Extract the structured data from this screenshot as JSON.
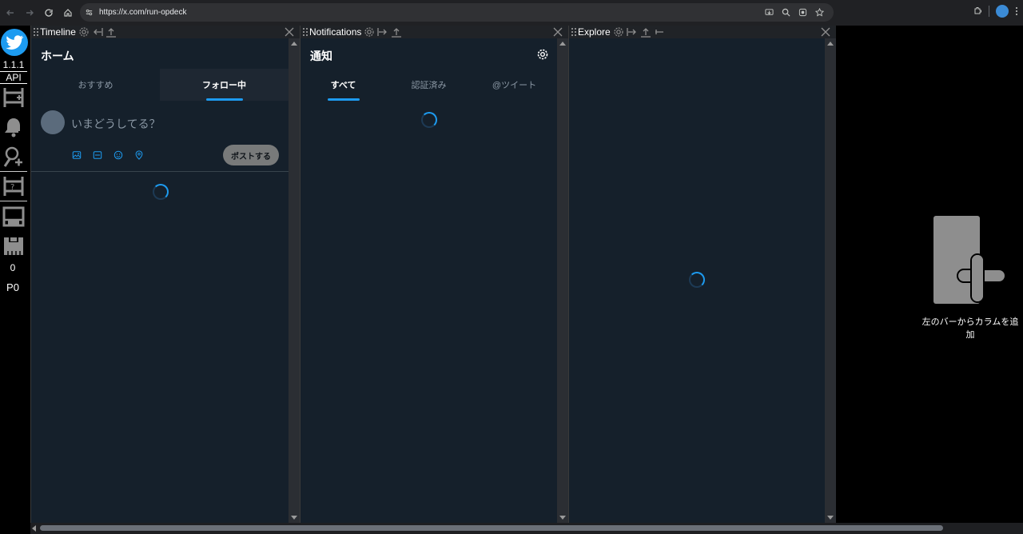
{
  "browser": {
    "url": "https://x.com/run-opdeck"
  },
  "leftbar": {
    "version": "1.1.1",
    "api_label": "API",
    "counter": "0",
    "post_count": "P0"
  },
  "columns": [
    {
      "header": "Timeline",
      "title": "ホーム",
      "tabs": [
        {
          "label": "おすすめ",
          "active": false
        },
        {
          "label": "フォロー中",
          "active": true
        }
      ],
      "composer": {
        "placeholder": "いまどうしてる？",
        "post_label": "ポストする"
      }
    },
    {
      "header": "Notifications",
      "title": "通知",
      "tabs": [
        {
          "label": "すべて",
          "active": true
        },
        {
          "label": "認証済み",
          "active": false
        },
        {
          "label": "@ツイート",
          "active": false
        }
      ]
    },
    {
      "header": "Explore"
    }
  ],
  "add_column": {
    "label": "左のバーからカラムを追加"
  },
  "colors": {
    "accent": "#1d9bf0",
    "column_bg": "#15202b",
    "header_bg": "#202327",
    "icon_gray": "#8e8e8e"
  },
  "icons": {
    "browser": [
      "back-arrow-icon",
      "forward-arrow-icon",
      "reload-icon",
      "home-icon",
      "site-settings-icon",
      "install-icon",
      "zoom-icon",
      "screenshot-icon",
      "bookmark-star-icon",
      "extensions-icon",
      "profile-icon",
      "menu-icon"
    ],
    "leftbar": [
      "twitter-bird-icon",
      "timeline-add-icon",
      "bell-icon",
      "search-user-icon",
      "list-icon",
      "save-icon",
      "load-icon"
    ],
    "column_header": [
      "grip-icon",
      "gear-icon",
      "move-left-icon",
      "move-right-icon",
      "upload-icon",
      "pin-icon",
      "close-icon"
    ],
    "composer": [
      "image-icon",
      "gif-icon",
      "emoji-icon",
      "location-icon"
    ]
  }
}
